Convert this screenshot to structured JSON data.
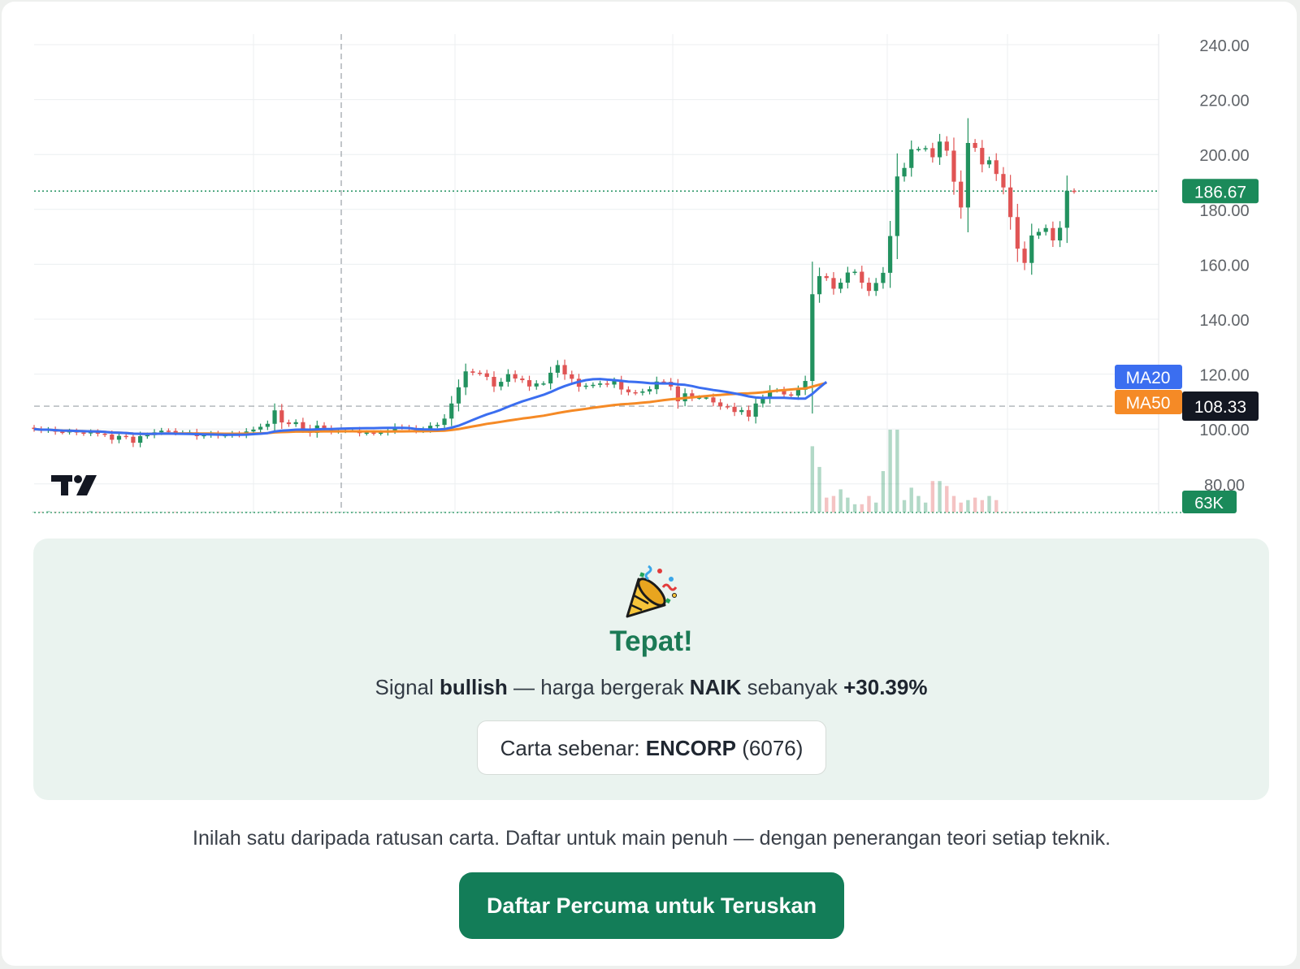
{
  "colors": {
    "up": "#22925f",
    "down": "#e05454",
    "ma20": "#3b6ef0",
    "ma50": "#f58a26",
    "accent": "#137d58",
    "panel": "#eaf3ef"
  },
  "chart_data": {
    "type": "candlestick",
    "y_ticks": [
      "240.00",
      "220.00",
      "200.00",
      "180.00",
      "160.00",
      "140.00",
      "120.00",
      "100.00",
      "80.00"
    ],
    "ylim": [
      78,
      244
    ],
    "grid": true,
    "current_price": "186.67",
    "reference_price": "108.33",
    "volume_label": "63K",
    "legend": [
      {
        "name": "MA20",
        "color": "#3b6ef0"
      },
      {
        "name": "MA50",
        "color": "#f58a26"
      }
    ],
    "close": [
      100.0,
      99.5,
      99.8,
      99.0,
      98.9,
      99.2,
      98.7,
      98.4,
      98.9,
      98.3,
      98.0,
      96.1,
      97.5,
      97.2,
      95.0,
      97.4,
      97.8,
      98.8,
      99.4,
      99.3,
      98.7,
      98.7,
      98.8,
      97.4,
      97.8,
      98.3,
      97.6,
      97.8,
      98.3,
      97.9,
      99.1,
      99.8,
      100.8,
      101.9,
      106.8,
      102.4,
      101.8,
      102.5,
      100.2,
      98.6,
      101.3,
      100.2,
      99.2,
      99.4,
      99.6,
      99.6,
      98.5,
      98.7,
      98.5,
      98.7,
      99.5,
      100.8,
      100.6,
      100.3,
      99.5,
      99.9,
      101.2,
      101.5,
      103.8,
      109.3,
      115.2,
      121.0,
      120.5,
      120.3,
      119.0,
      115.5,
      117.2,
      120.0,
      118.4,
      117.8,
      115.5,
      116.6,
      116.6,
      120.5,
      123.3,
      119.9,
      118.3,
      115.4,
      115.8,
      116.1,
      116.6,
      116.2,
      117.5,
      114.4,
      113.4,
      113.2,
      113.7,
      114.5,
      117.3,
      117.2,
      115.5,
      110.1,
      113.0,
      111.5,
      111.5,
      111.5,
      109.7,
      108.3,
      108.1,
      106.2,
      106.9,
      104.5,
      109.3,
      111.1,
      114.1,
      114.1,
      112.6,
      112.2,
      114.3,
      117.5,
      149.1,
      155.7,
      155.0,
      151.1,
      153.3,
      157.0,
      157.3,
      153.3,
      150.3,
      153.2,
      156.9,
      170.3,
      192.0,
      195.1,
      201.9,
      202.0,
      202.3,
      199.0,
      204.7,
      201.4,
      190.1,
      180.7,
      204.2,
      202.4,
      196.4,
      197.9,
      192.9,
      188.0,
      177.2,
      165.7,
      160.5,
      170.5,
      171.8,
      173.2,
      168.7,
      173.3,
      186.8,
      186.6
    ],
    "volume_k": [
      1,
      1,
      2,
      1,
      1,
      1,
      1,
      1,
      2,
      1,
      1,
      1,
      1,
      1,
      1,
      1,
      1,
      1,
      1,
      1,
      1,
      1,
      1,
      1,
      1,
      1,
      1,
      1,
      1,
      1,
      1,
      1,
      1,
      1,
      2,
      1,
      1,
      1,
      1,
      1,
      1,
      1,
      1,
      1,
      1,
      1,
      1,
      1,
      1,
      1,
      1,
      1,
      1,
      1,
      1,
      1,
      1,
      1,
      1,
      1,
      1,
      1,
      1,
      1,
      1,
      1,
      1,
      1,
      1,
      1,
      1,
      1,
      1,
      1,
      2,
      1,
      1,
      1,
      1,
      1,
      1,
      1,
      1,
      1,
      1,
      1,
      1,
      1,
      1,
      1,
      1,
      1,
      1,
      1,
      1,
      1,
      1,
      1,
      1,
      1,
      1,
      1,
      1,
      1,
      1,
      1,
      1,
      1,
      1,
      1,
      80,
      55,
      18,
      20,
      28,
      18,
      10,
      10,
      20,
      12,
      50,
      100,
      100,
      15,
      30,
      20,
      12,
      38,
      38,
      32,
      20,
      12,
      15,
      18,
      15,
      20,
      15,
      1,
      1,
      1,
      1,
      1,
      1,
      1,
      1,
      1,
      1,
      1
    ]
  },
  "result": {
    "title": "Tepat!",
    "signal_prefix": "Signal ",
    "signal_word": "bullish",
    "signal_mid": " — harga bergerak ",
    "direction": "NAIK",
    "signal_suffix": " sebanyak ",
    "change": "+30.39%",
    "actual_prefix": "Carta sebenar: ",
    "ticker": "ENCORP",
    "code": " (6076)"
  },
  "footer": {
    "note": "Inilah satu daripada ratusan carta. Daftar untuk main penuh — dengan penerangan teori setiap teknik.",
    "cta": "Daftar Percuma untuk Teruskan"
  }
}
